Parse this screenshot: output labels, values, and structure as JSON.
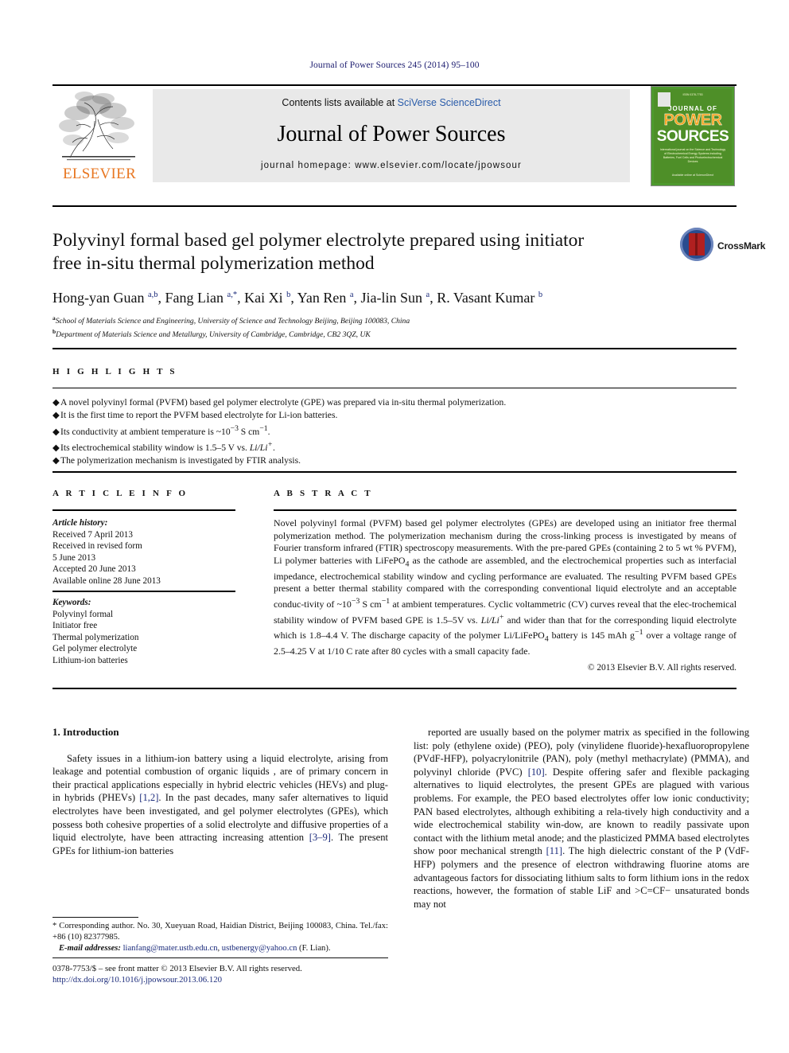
{
  "running_head": "Journal of Power Sources 245 (2014) 95–100",
  "banner": {
    "contents_prefix": "Contents lists available at ",
    "contents_link": "SciVerse ScienceDirect",
    "journal_title": "Journal of Power Sources",
    "homepage": "journal homepage: www.elsevier.com/locate/jpowsour",
    "publisher_name": "ELSEVIER",
    "publisher_logo_icon": "elsevier-tree-icon",
    "cover": {
      "top_text": "ISSN 0378-7753",
      "line1": "JOURNAL OF",
      "line2": "POWER",
      "line3": "SOURCES",
      "blurb": "International journal on the Science and Technology of Electrochemical Energy Systems including Batteries, Fuel Cells and Photoelectrochemical Devices",
      "bottom": "Available online at\nScienceDirect"
    }
  },
  "article": {
    "title": "Polyvinyl formal based gel polymer electrolyte prepared using initiator free in-situ thermal polymerization method",
    "crossmark_label": "CrossMark",
    "authors_html": "Hong-yan Guan <sup>a,b</sup>, Fang Lian <sup>a,</sup><sup>*</sup>, Kai Xi <sup>b</sup>, Yan Ren <sup>a</sup>, Jia-lin Sun <sup>a</sup>, R. Vasant Kumar <sup>b</sup>",
    "affiliations": [
      {
        "marker": "a",
        "text": "School of Materials Science and Engineering, University of Science and Technology Beijing, Beijing 100083, China"
      },
      {
        "marker": "b",
        "text": "Department of Materials Science and Metallurgy, University of Cambridge, Cambridge, CB2 3QZ, UK"
      }
    ]
  },
  "highlights": {
    "heading": "H I G H L I G H T S",
    "items_html": [
      "A novel polyvinyl formal (PVFM) based gel polymer electrolyte (GPE) was prepared via in-situ thermal polymerization.",
      "It is the first time to report the PVFM based electrolyte for Li-ion batteries.",
      "Its conductivity at ambient temperature is ~10<sup>&#8722;3</sup> S cm<sup>&#8722;1</sup>.",
      "Its electrochemical stability window is 1.5–5 V vs. <i>Li/Li<sup>+</sup></i>.",
      "The polymerization mechanism is investigated by FTIR analysis."
    ]
  },
  "article_info": {
    "heading": "A R T I C L E  I N F O",
    "history_label": "Article history:",
    "history": [
      "Received 7 April 2013",
      "Received in revised form",
      "5 June 2013",
      "Accepted 20 June 2013",
      "Available online 28 June 2013"
    ],
    "keywords_label": "Keywords:",
    "keywords": [
      "Polyvinyl formal",
      "Initiator free",
      "Thermal polymerization",
      "Gel polymer electrolyte",
      "Lithium-ion batteries"
    ]
  },
  "abstract": {
    "heading": "A B S T R A C T",
    "text_html": "Novel polyvinyl formal (PVFM) based gel polymer electrolytes (GPEs) are developed using an initiator free thermal polymerization method. The polymerization mechanism during the cross-linking process is investigated by means of Fourier transform infrared (FTIR) spectroscopy measurements. With the pre-pared GPEs (containing 2 to 5 wt % PVFM), Li polymer batteries with LiFePO<sub>4</sub> as the cathode are assembled, and the electrochemical properties such as interfacial impedance, electrochemical stability window and cycling performance are evaluated. The resulting PVFM based GPEs present a better thermal stability compared with the corresponding conventional liquid electrolyte and an acceptable conduc-tivity of ~10<sup>&#8722;3</sup> S cm<sup>&#8722;1</sup> at ambient temperatures. Cyclic voltammetric (CV) curves reveal that the elec-trochemical stability window of PVFM based GPE is 1.5–5V vs. <i>Li/Li</i><sup>+</sup> and wider than that for the corresponding liquid electrolyte which is 1.8–4.4 V. The discharge capacity of the polymer Li/LiFePO<sub>4</sub> battery is 145 mAh g<sup>&#8722;1</sup> over a voltage range of 2.5–4.25 V at 1/10 C rate after 80 cycles with a small capacity fade.",
    "copyright": "© 2013 Elsevier B.V. All rights reserved."
  },
  "body": {
    "section_number_title": "1.  Introduction",
    "left_html": "Safety issues in a lithium-ion battery using a liquid electrolyte, arising from leakage and potential combustion of organic liquids , are of primary concern in their practical applications especially in hybrid electric vehicles (HEVs) and plug-in hybrids (PHEVs) <span class=\"ref\">[1,2]</span>. In the past decades, many safer alternatives to liquid electrolytes have been investigated, and gel polymer electrolytes (GPEs), which possess both cohesive properties of a solid electrolyte and diffusive properties of a liquid electrolyte, have been attracting increasing attention <span class=\"ref\">[3–9]</span>. The present GPEs for lithium-ion batteries",
    "right_html": "reported are usually based on the polymer matrix as specified in the following list: poly (ethylene oxide) (PEO), poly (vinylidene fluoride)-hexafluoropropylene (PVdF-HFP), polyacrylonitrile (PAN), poly (methyl methacrylate) (PMMA), and polyvinyl chloride (PVC) <span class=\"ref\">[10]</span>. Despite offering safer and flexible packaging alternatives to liquid electrolytes, the present GPEs are plagued with various problems. For example, the PEO based electrolytes offer low ionic conductivity; PAN based electrolytes, although exhibiting a rela-tively high conductivity and a wide electrochemical stability win-dow, are known to readily passivate upon contact with the lithium metal anode; and the plasticized PMMA based electrolytes show poor mechanical strength <span class=\"ref\">[11]</span>. The high dielectric constant of the P (VdF-HFP) polymers and the presence of electron withdrawing fluorine atoms are advantageous factors for dissociating lithium salts to form lithium ions in the redox reactions, however, the formation of stable LiF and &gt;C&#61;CF&#8722; unsaturated bonds may not"
  },
  "footnote": {
    "text_html": "* Corresponding author. No. 30, Xueyuan Road, Haidian District, Beijing 100083, China. Tel./fax: +86 (10) 82377985.",
    "email_label": "E-mail addresses:",
    "email_html": "<span class=\"mail\">lianfang@mater.ustb.edu.cn</span>, <span class=\"mail\">ustbenergy@yahoo.cn</span> (F. Lian)."
  },
  "footer": {
    "line1_html": "0378-7753/$ &#8211; see front matter © 2013 Elsevier B.V. All rights reserved.",
    "doi": "http://dx.doi.org/10.1016/j.jpowsour.2013.06.120"
  },
  "colors": {
    "link_blue": "#2a5caa",
    "reference_blue": "#1a2a7a",
    "elsevier_orange": "#E87722",
    "cover_green": "#4e8f28",
    "banner_gray": "#e9e9e9"
  }
}
